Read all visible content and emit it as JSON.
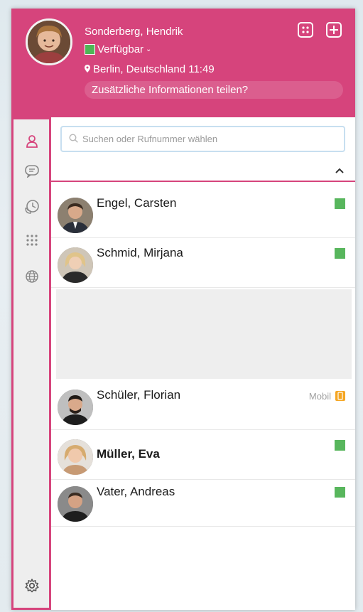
{
  "profile": {
    "name": "Sonderberg, Hendrik",
    "status": "Verfügbar",
    "location": "Berlin, Deutschland 11:49",
    "share_prompt": "Zusätzliche Informationen teilen?",
    "avatar_icon": "user-avatar",
    "status_color": "#4fb556"
  },
  "header_buttons": {
    "apps_icon": "apps-grid-icon",
    "add_icon": "plus-icon"
  },
  "sidebar": {
    "items": [
      {
        "name": "contacts",
        "icon": "person-icon",
        "active": true
      },
      {
        "name": "chat",
        "icon": "chat-icon"
      },
      {
        "name": "call-history",
        "icon": "history-phone-icon"
      },
      {
        "name": "dialpad",
        "icon": "dialpad-icon"
      },
      {
        "name": "web",
        "icon": "globe-icon"
      }
    ],
    "settings_icon": "gear-icon"
  },
  "search": {
    "placeholder": "Suchen oder Rufnummer wählen"
  },
  "contacts": [
    {
      "name": "Engel, Carsten",
      "status": "available",
      "status_color": "#58b65d"
    },
    {
      "name": "Schmid, Mirjana",
      "status": "available",
      "status_color": "#58b65d"
    },
    {
      "name": "Schüler, Florian",
      "status": "mobile",
      "status_label": "Mobil",
      "status_color": "#f5a623"
    },
    {
      "name": "Müller, Eva",
      "status": "available",
      "status_color": "#58b65d"
    },
    {
      "name": "Vater, Andreas",
      "status": "available",
      "status_color": "#58b65d"
    }
  ],
  "accent_color": "#d6447c"
}
